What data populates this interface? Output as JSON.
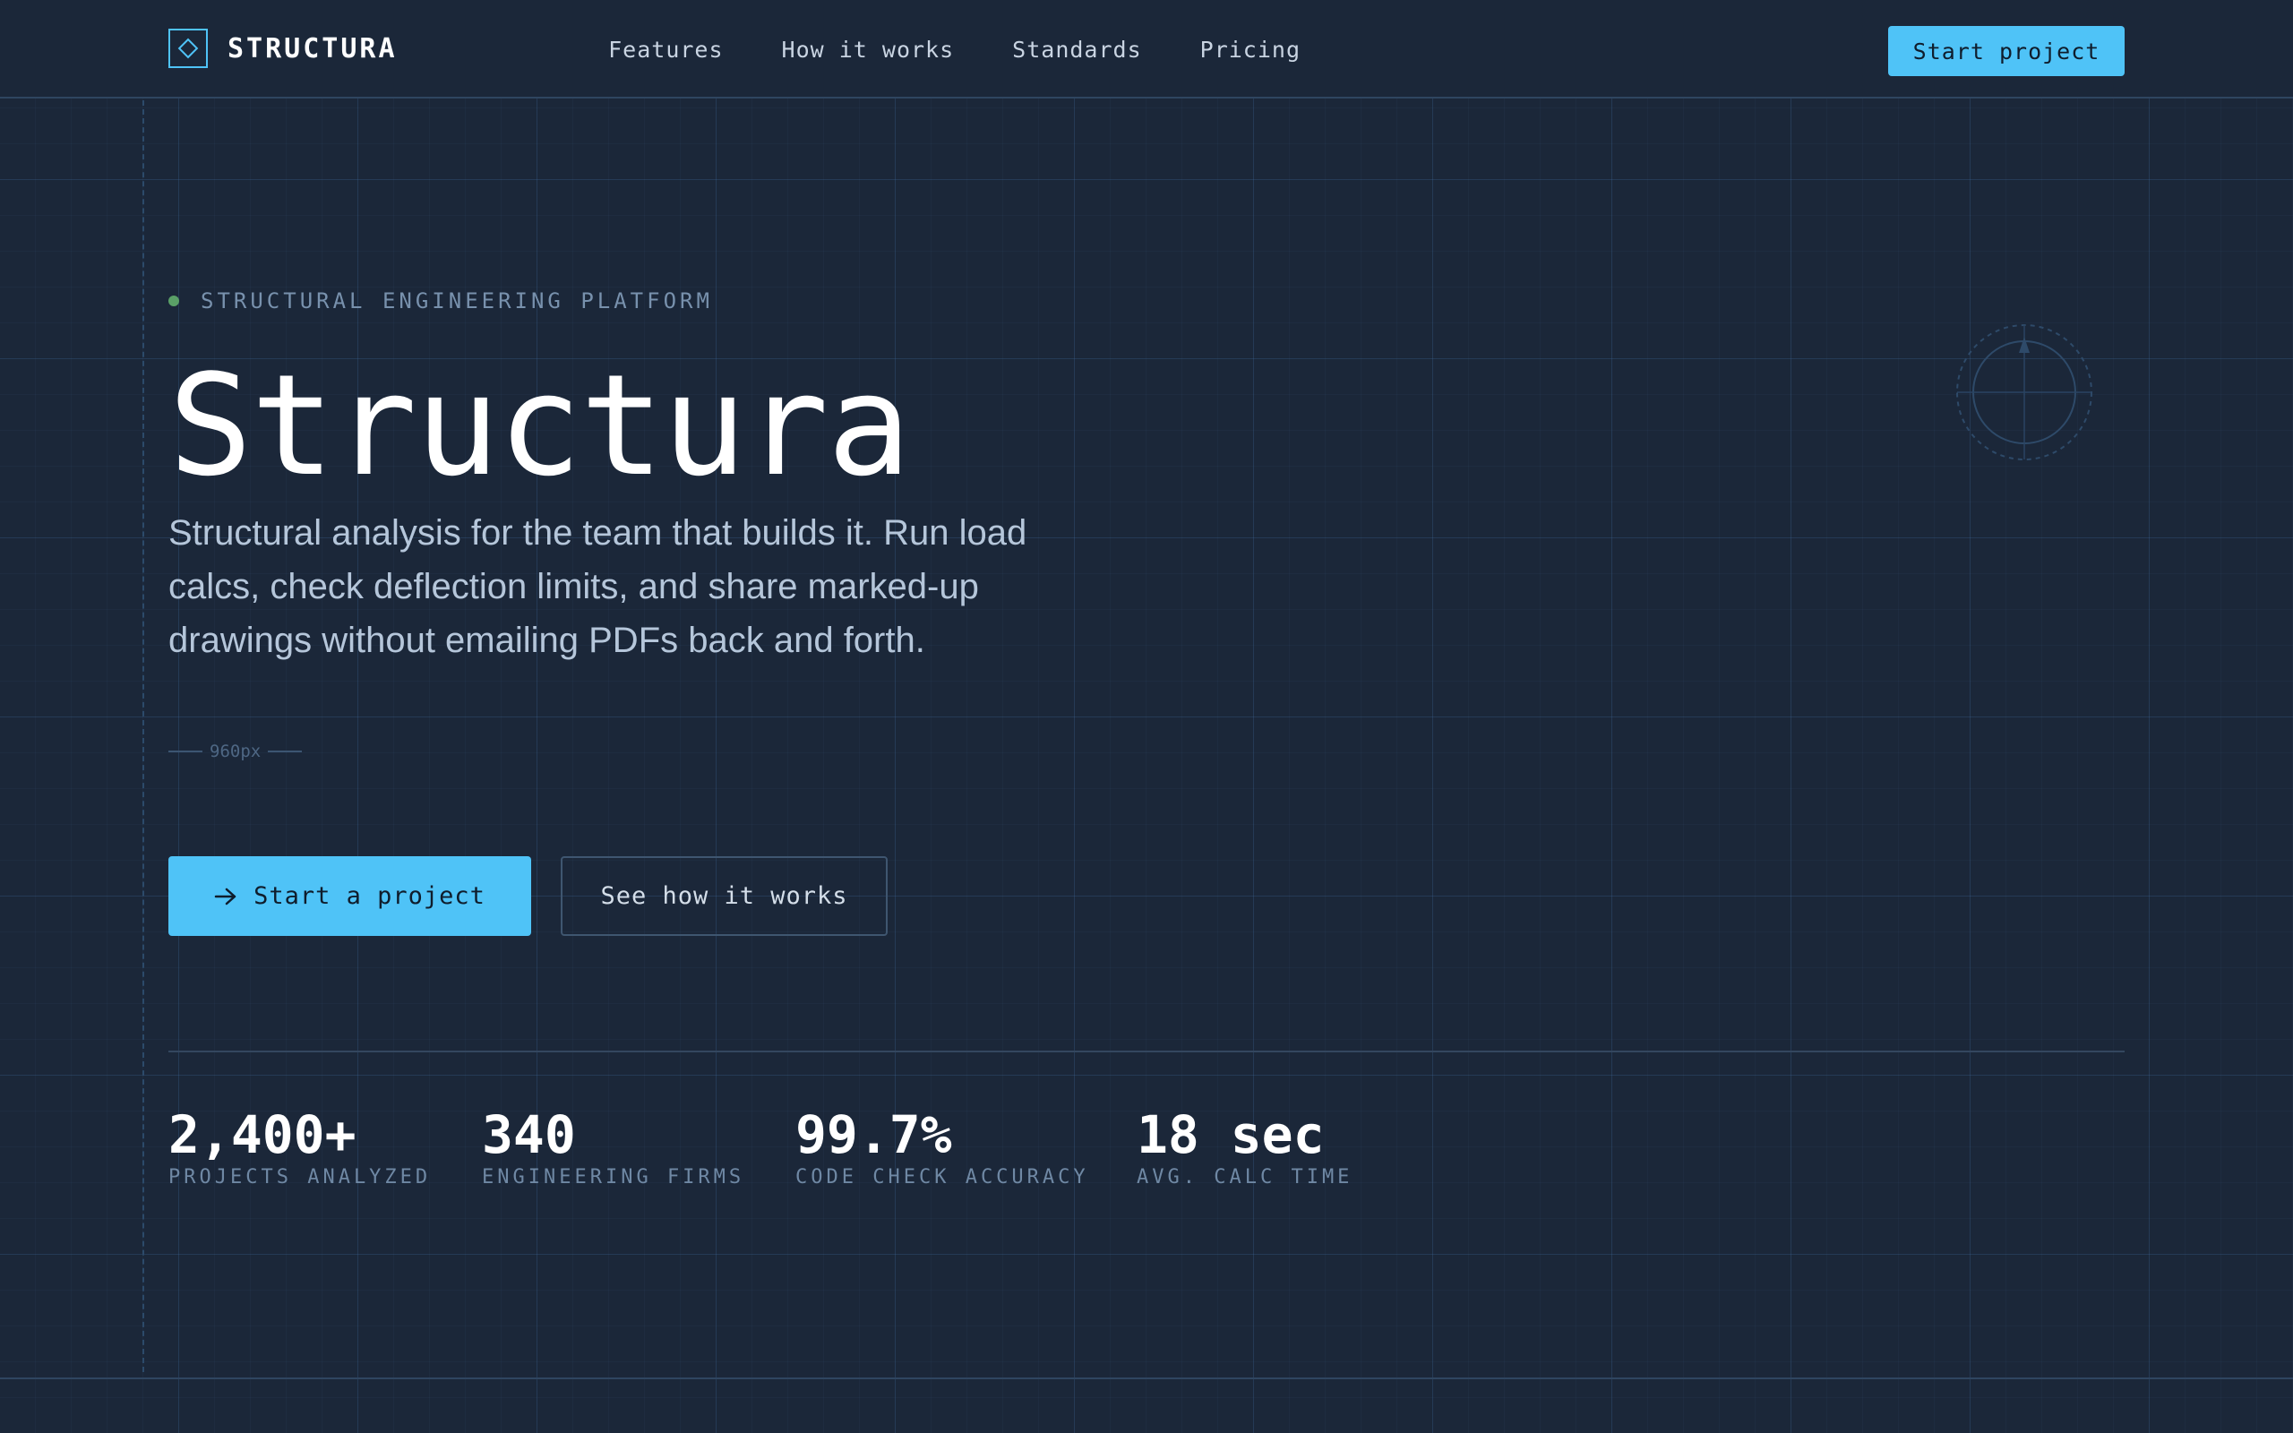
{
  "brand": {
    "name": "STRUCTURA",
    "icon": "diamond-logo-icon"
  },
  "nav": {
    "links": [
      "Features",
      "How it works",
      "Standards",
      "Pricing"
    ],
    "cta_label": "Start project"
  },
  "hero": {
    "eyebrow": "STRUCTURAL ENGINEERING PLATFORM",
    "title": "Structura",
    "description": "Structural analysis for the team that builds it. Run load calcs, check deflection limits, and share marked-up drawings without emailing PDFs back and forth.",
    "dimension_label": "960px",
    "primary_button": "Start a project",
    "secondary_button": "See how it works"
  },
  "stats": [
    {
      "value": "2,400+",
      "label": "PROJECTS ANALYZED"
    },
    {
      "value": "340",
      "label": "ENGINEERING FIRMS"
    },
    {
      "value": "99.7%",
      "label": "CODE CHECK ACCURACY"
    },
    {
      "value": "18 sec",
      "label": "AVG. CALC TIME"
    }
  ],
  "colors": {
    "background": "#1b2739",
    "accent": "#4fc3f7",
    "status_dot": "#5aa067",
    "muted_text": "#7891ad"
  }
}
